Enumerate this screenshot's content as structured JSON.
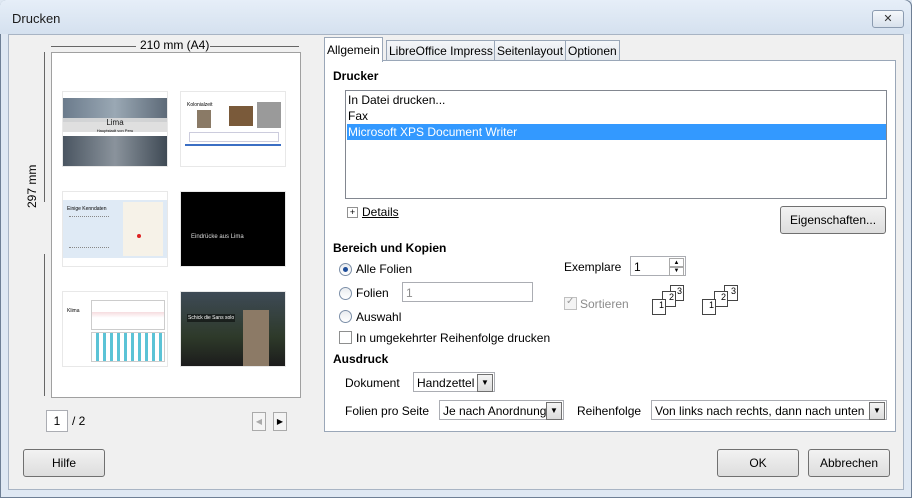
{
  "window": {
    "title": "Drucken",
    "close_glyph": "✕"
  },
  "preview": {
    "width_label": "210 mm (A4)",
    "height_label": "297 mm",
    "page_current": "1",
    "page_total": "/ 2",
    "slides": [
      {
        "title": "Lima",
        "subtitle": "Hauptstadt von Peru"
      },
      {
        "title": "Kolonialzeit"
      },
      {
        "title": "Einige Kenndaten"
      },
      {
        "title": "Eindrücke aus Lima"
      },
      {
        "title": "Klima"
      },
      {
        "title": "Schick die Sans solo"
      }
    ]
  },
  "tabs": [
    {
      "label": "Allgemein",
      "active": true
    },
    {
      "label": "LibreOffice Impress",
      "active": false
    },
    {
      "label": "Seitenlayout",
      "active": false
    },
    {
      "label": "Optionen",
      "active": false
    }
  ],
  "printer": {
    "heading": "Drucker",
    "items": [
      "In Datei drucken...",
      "Fax",
      "Microsoft XPS Document Writer"
    ],
    "selected_index": 2,
    "details_label": "Details",
    "properties_button": "Eigenschaften..."
  },
  "range": {
    "heading": "Bereich und Kopien",
    "all_slides": "Alle Folien",
    "slides": "Folien",
    "slides_value": "1",
    "selection": "Auswahl",
    "reverse": "In umgekehrter Reihenfolge drucken",
    "copies_label": "Exemplare",
    "copies_value": "1",
    "collate": "Sortieren"
  },
  "output": {
    "heading": "Ausdruck",
    "document_label": "Dokument",
    "document_value": "Handzettel",
    "per_page_label": "Folien pro Seite",
    "per_page_value": "Je nach Anordnung",
    "order_label": "Reihenfolge",
    "order_value": "Von links nach rechts, dann nach unten"
  },
  "buttons": {
    "help": "Hilfe",
    "ok": "OK",
    "cancel": "Abbrechen"
  }
}
